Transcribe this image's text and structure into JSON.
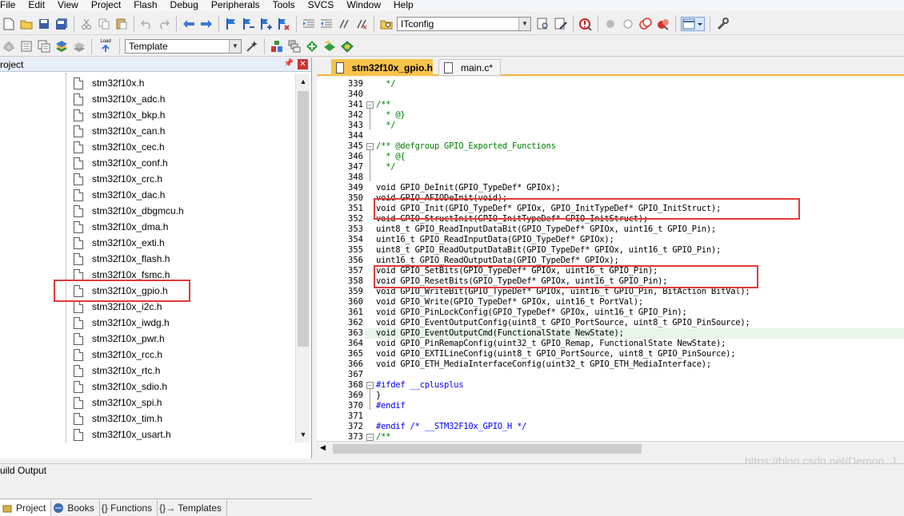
{
  "menu": [
    "File",
    "Edit",
    "View",
    "Project",
    "Flash",
    "Debug",
    "Peripherals",
    "Tools",
    "SVCS",
    "Window",
    "Help"
  ],
  "toolbar1": {
    "icons": [
      "new-file-icon",
      "open-icon",
      "save-icon",
      "save-all-icon",
      "cut-icon",
      "copy-icon",
      "paste-icon",
      "undo-icon",
      "redo-icon",
      "back-icon",
      "forward-icon",
      "bookmark-icon",
      "prev-bookmark-icon",
      "next-bookmark-icon",
      "clear-bookmarks-icon",
      "indent-icon",
      "unindent-icon",
      "comment-icon",
      "uncomment-icon",
      "find-in-files-icon"
    ],
    "find_combo_value": "ITconfig"
  },
  "toolbar2": {
    "target_combo_value": "Template",
    "load_label": "Load"
  },
  "project_panel": {
    "title": "roject",
    "files": [
      "stm32f10x.h",
      "stm32f10x_adc.h",
      "stm32f10x_bkp.h",
      "stm32f10x_can.h",
      "stm32f10x_cec.h",
      "stm32f10x_conf.h",
      "stm32f10x_crc.h",
      "stm32f10x_dac.h",
      "stm32f10x_dbgmcu.h",
      "stm32f10x_dma.h",
      "stm32f10x_exti.h",
      "stm32f10x_flash.h",
      "stm32f10x_fsmc.h",
      "stm32f10x_gpio.h",
      "stm32f10x_i2c.h",
      "stm32f10x_iwdg.h",
      "stm32f10x_pwr.h",
      "stm32f10x_rcc.h",
      "stm32f10x_rtc.h",
      "stm32f10x_sdio.h",
      "stm32f10x_spi.h",
      "stm32f10x_tim.h",
      "stm32f10x_usart.h"
    ],
    "tabs": [
      "Project",
      "Books",
      "{} Functions",
      "{}→ Templates"
    ]
  },
  "editor": {
    "tabs": [
      "stm32f10x_gpio.h",
      "main.c*"
    ],
    "lines": [
      {
        "n": "339",
        "t": "  */"
      },
      {
        "n": "340",
        "t": ""
      },
      {
        "n": "341",
        "t": "/**"
      },
      {
        "n": "342",
        "t": "  * @}"
      },
      {
        "n": "343",
        "t": "  */"
      },
      {
        "n": "344",
        "t": ""
      },
      {
        "n": "345",
        "t": "/** @defgroup GPIO_Exported_Functions"
      },
      {
        "n": "346",
        "t": "  * @{"
      },
      {
        "n": "347",
        "t": "  */"
      },
      {
        "n": "348",
        "t": ""
      },
      {
        "n": "349",
        "t": "void GPIO_DeInit(GPIO_TypeDef* GPIOx);"
      },
      {
        "n": "350",
        "t": "void GPIO_AFIODeInit(void);"
      },
      {
        "n": "351",
        "t": "void GPIO_Init(GPIO_TypeDef* GPIOx, GPIO_InitTypeDef* GPIO_InitStruct);"
      },
      {
        "n": "352",
        "t": "void GPIO_StructInit(GPIO_InitTypeDef* GPIO_InitStruct);"
      },
      {
        "n": "353",
        "t": "uint8_t GPIO_ReadInputDataBit(GPIO_TypeDef* GPIOx, uint16_t GPIO_Pin);"
      },
      {
        "n": "354",
        "t": "uint16_t GPIO_ReadInputData(GPIO_TypeDef* GPIOx);"
      },
      {
        "n": "355",
        "t": "uint8_t GPIO_ReadOutputDataBit(GPIO_TypeDef* GPIOx, uint16_t GPIO_Pin);"
      },
      {
        "n": "356",
        "t": "uint16_t GPIO_ReadOutputData(GPIO_TypeDef* GPIOx);"
      },
      {
        "n": "357",
        "t": "void GPIO_SetBits(GPIO_TypeDef* GPIOx, uint16_t GPIO_Pin);"
      },
      {
        "n": "358",
        "t": "void GPIO_ResetBits(GPIO_TypeDef* GPIOx, uint16_t GPIO_Pin);"
      },
      {
        "n": "359",
        "t": "void GPIO_WriteBit(GPIO_TypeDef* GPIOx, uint16_t GPIO_Pin, BitAction BitVal);"
      },
      {
        "n": "360",
        "t": "void GPIO_Write(GPIO_TypeDef* GPIOx, uint16_t PortVal);"
      },
      {
        "n": "361",
        "t": "void GPIO_PinLockConfig(GPIO_TypeDef* GPIOx, uint16_t GPIO_Pin);"
      },
      {
        "n": "362",
        "t": "void GPIO_EventOutputConfig(uint8_t GPIO_PortSource, uint8_t GPIO_PinSource);"
      },
      {
        "n": "363",
        "t": "void GPIO_EventOutputCmd(FunctionalState NewState);"
      },
      {
        "n": "364",
        "t": "void GPIO_PinRemapConfig(uint32_t GPIO_Remap, FunctionalState NewState);"
      },
      {
        "n": "365",
        "t": "void GPIO_EXTILineConfig(uint8_t GPIO_PortSource, uint8_t GPIO_PinSource);"
      },
      {
        "n": "366",
        "t": "void GPIO_ETH_MediaInterfaceConfig(uint32_t GPIO_ETH_MediaInterface);"
      },
      {
        "n": "367",
        "t": ""
      },
      {
        "n": "368",
        "t": "#ifdef __cplusplus"
      },
      {
        "n": "369",
        "t": "}"
      },
      {
        "n": "370",
        "t": "#endif"
      },
      {
        "n": "371",
        "t": ""
      },
      {
        "n": "372",
        "t": "#endif /* __STM32F10x_GPIO_H */"
      },
      {
        "n": "373",
        "t": "/**"
      }
    ]
  },
  "status_bar": {
    "label": "uild Output"
  },
  "watermark": "https://blog.csdn.net/Demon_J"
}
